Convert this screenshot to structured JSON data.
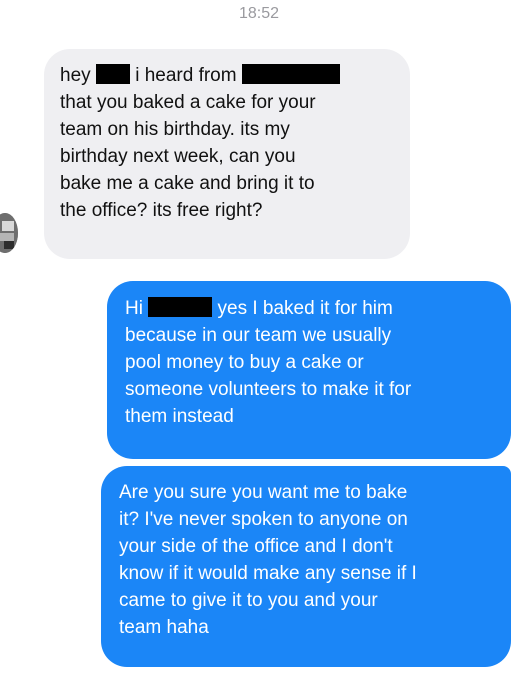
{
  "header": {
    "timestamp": "18:52"
  },
  "messages": [
    {
      "direction": "incoming",
      "lines": [
        [
          "hey",
          "[redacted]",
          "i heard from",
          "[redacted]"
        ],
        "that you baked a cake for your",
        "team on his birthday. its my",
        "birthday next week, can you",
        "bake me a cake and bring it to",
        "the office? its free right?"
      ]
    },
    {
      "direction": "outgoing",
      "lines": [
        [
          "Hi",
          "[redacted]",
          "yes I baked it for him"
        ],
        "because in our team we usually",
        "pool money to buy a cake or",
        "someone volunteers to make it for",
        "them instead"
      ]
    },
    {
      "direction": "outgoing",
      "lines": [
        "Are you sure you want me to bake",
        "it? I've never spoken to anyone on",
        "your side of the office and I don't",
        "know if it would make any sense if I",
        "came to give it to you and your",
        "team haha"
      ]
    }
  ],
  "colors": {
    "incoming_bubble": "#efeff2",
    "outgoing_bubble": "#1b86f7",
    "timestamp_text": "#9a9a9f"
  },
  "icons": {
    "contact_avatar": "avatar-icon"
  }
}
